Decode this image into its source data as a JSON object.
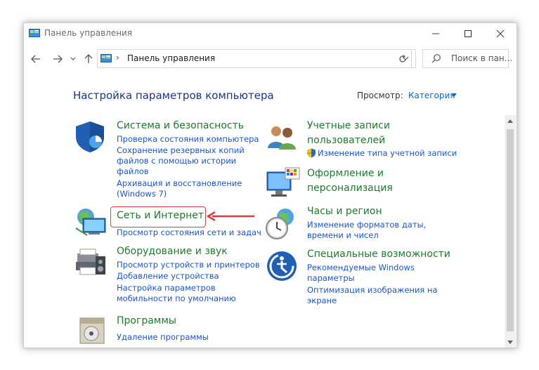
{
  "window": {
    "title": "Панель управления"
  },
  "address": {
    "separator": "›",
    "path": "Панель управления"
  },
  "search": {
    "placeholder": "Поиск в пан..."
  },
  "content": {
    "title": "Настройка параметров компьютера",
    "view_label": "Просмотр:",
    "view_value": "Категория"
  },
  "categories": [
    {
      "icon": "shield-icon",
      "title": "Система и безопасность",
      "links": [
        "Проверка состояния компьютера",
        "Сохранение резервных копий",
        "файлов с помощью истории",
        "файлов",
        "Архивация и восстановление",
        "(Windows 7)"
      ]
    },
    {
      "icon": "network-icon",
      "title": "Сеть и Интернет",
      "links": [
        "Просмотр состояния сети и задач"
      ]
    },
    {
      "icon": "printer-icon",
      "title": "Оборудование и звук",
      "links": [
        "Просмотр устройств и принтеров",
        "Добавление устройства",
        "Настройка параметров",
        "мобильности по умолчанию"
      ]
    },
    {
      "icon": "programs-icon",
      "title": "Программы",
      "links": [
        "Удаление программы"
      ]
    },
    {
      "icon": "users-icon",
      "title_lines": [
        "Учетные записи",
        "пользователей"
      ],
      "links": [
        "Изменение типа учетной записи"
      ]
    },
    {
      "icon": "monitor-palette-icon",
      "title_lines": [
        "Оформление и",
        "персонализация"
      ],
      "links": []
    },
    {
      "icon": "clock-globe-icon",
      "title": "Часы и регион",
      "links": [
        "Изменение форматов даты,",
        "времени и чисел"
      ]
    },
    {
      "icon": "accessibility-icon",
      "title": "Специальные возможности",
      "links": [
        "Рекомендуемые Windows",
        "параметры",
        "Оптимизация изображения на",
        "экране"
      ]
    }
  ],
  "colors": {
    "category_title": "#1e7a2e",
    "link": "#1a54c8",
    "heading": "#1e3287",
    "annotation": "#e23b3b"
  }
}
